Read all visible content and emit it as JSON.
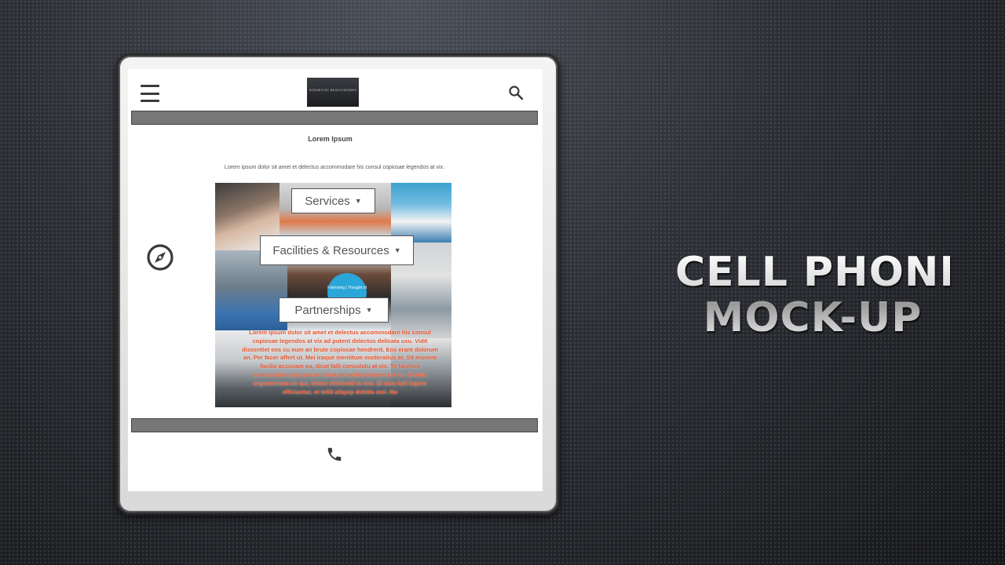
{
  "headline": {
    "line1": "CELL PHONE",
    "line2": "MOCK-UP"
  },
  "header": {
    "menu_icon": "hamburger-menu-icon",
    "logo_text": "SCENES BY BEACH BODIES",
    "search_icon": "search-icon"
  },
  "main": {
    "title": "Lorem Ipsum",
    "description": "Lorem ipsum dolor sit amet et delectus accommodare his consul copiosae legendos at vix.",
    "side_icon": "compass-icon",
    "nav_buttons": [
      {
        "label": "Services"
      },
      {
        "label": "Facilities & Resources"
      },
      {
        "label": "Partnerships"
      }
    ],
    "badge_text": "Fatmining | Thought of",
    "overlay_text": "Lorem ipsum dolor sit amet et delectus accommodare his consul copiosae legendos at vix ad putent delectus delicata usu. Vidit dissentiet eos cu eum an brute copiosae hendrerit. Eos erant dolorum an. Per facer affert ut. Mei iraque mentitum moderatius at. Sit munere facilis accusam eu, dicat falli consulatu at vis. Te facilisis mnesarchum qui posse omnium mediocritatem est cu. Modus argumentum ne qui, tation efficiendi in eos. Ei mea falli legere efficiantur, et tollit aliquip debitis mei. No"
  },
  "footer": {
    "phone_icon": "phone-icon"
  },
  "colors": {
    "bar": "#777777",
    "overlay_text": "#e8552d",
    "badge": "#2aa6d9"
  }
}
